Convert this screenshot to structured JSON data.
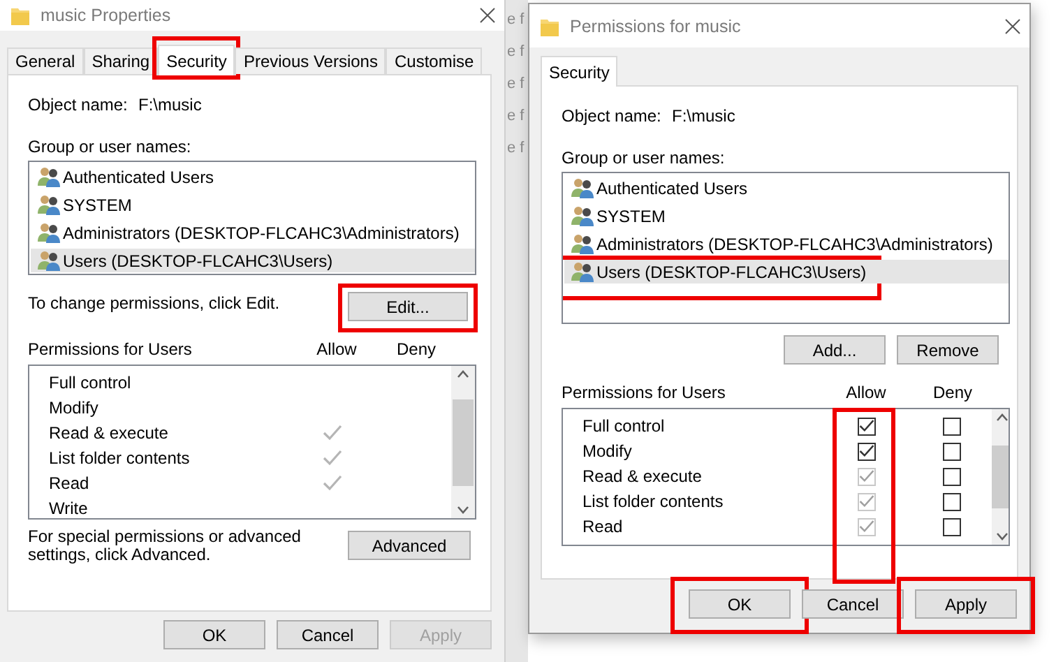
{
  "properties_window": {
    "title": "music Properties",
    "tabs": [
      {
        "label": "General",
        "selected": false,
        "highlighted": false
      },
      {
        "label": "Sharing",
        "selected": false,
        "highlighted": false
      },
      {
        "label": "Security",
        "selected": true,
        "highlighted": true
      },
      {
        "label": "Previous Versions",
        "selected": false,
        "highlighted": false
      },
      {
        "label": "Customise",
        "selected": false,
        "highlighted": false
      }
    ],
    "object_label": "Object name:",
    "object_value": "F:\\music",
    "group_label": "Group or user names:",
    "users": [
      {
        "name": "Authenticated Users",
        "selected": false,
        "highlighted": false
      },
      {
        "name": "SYSTEM",
        "selected": false,
        "highlighted": false
      },
      {
        "name": "Administrators (DESKTOP-FLCAHC3\\Administrators)",
        "selected": false,
        "highlighted": false
      },
      {
        "name": "Users (DESKTOP-FLCAHC3\\Users)",
        "selected": true,
        "highlighted": false
      }
    ],
    "edit_hint": "To change permissions, click Edit.",
    "edit_button": {
      "label": "Edit...",
      "highlighted": true
    },
    "permissions_label": "Permissions for Users",
    "allow_label": "Allow",
    "deny_label": "Deny",
    "permissions": [
      {
        "label": "Full control",
        "allow": false,
        "deny": false
      },
      {
        "label": "Modify",
        "allow": false,
        "deny": false
      },
      {
        "label": "Read & execute",
        "allow": true,
        "deny": false
      },
      {
        "label": "List folder contents",
        "allow": true,
        "deny": false
      },
      {
        "label": "Read",
        "allow": true,
        "deny": false
      },
      {
        "label": "Write",
        "allow": false,
        "deny": false
      }
    ],
    "advanced_hint": "For special permissions or advanced settings, click Advanced.",
    "advanced_button": "Advanced",
    "buttons": [
      {
        "label": "OK",
        "disabled": false,
        "highlighted": false
      },
      {
        "label": "Cancel",
        "disabled": false,
        "highlighted": false
      },
      {
        "label": "Apply",
        "disabled": true,
        "highlighted": false
      }
    ]
  },
  "background_fragments": [
    "e f",
    "e f",
    "e f",
    "e f",
    "e f"
  ],
  "permissions_window": {
    "title": "Permissions for music",
    "tabs": [
      {
        "label": "Security",
        "selected": true,
        "highlighted": false
      }
    ],
    "object_label": "Object name:",
    "object_value": "F:\\music",
    "group_label": "Group or user names:",
    "users": [
      {
        "name": "Authenticated Users",
        "selected": false,
        "highlighted": false
      },
      {
        "name": "SYSTEM",
        "selected": false,
        "highlighted": false
      },
      {
        "name": "Administrators (DESKTOP-FLCAHC3\\Administrators)",
        "selected": false,
        "highlighted": false
      },
      {
        "name": "Users (DESKTOP-FLCAHC3\\Users)",
        "selected": true,
        "highlighted": true
      }
    ],
    "add_button": "Add...",
    "remove_button": "Remove",
    "permissions_label": "Permissions for Users",
    "allow_label": "Allow",
    "deny_label": "Deny",
    "allow_highlighted": true,
    "permissions": [
      {
        "label": "Full control",
        "allow": true,
        "allow_disabled": false,
        "deny": false
      },
      {
        "label": "Modify",
        "allow": true,
        "allow_disabled": false,
        "deny": false
      },
      {
        "label": "Read & execute",
        "allow": true,
        "allow_disabled": true,
        "deny": false
      },
      {
        "label": "List folder contents",
        "allow": true,
        "allow_disabled": true,
        "deny": false
      },
      {
        "label": "Read",
        "allow": true,
        "allow_disabled": true,
        "deny": false
      }
    ],
    "buttons": [
      {
        "label": "OK",
        "disabled": false,
        "highlighted": true
      },
      {
        "label": "Cancel",
        "disabled": false,
        "highlighted": false
      },
      {
        "label": "Apply",
        "disabled": false,
        "highlighted": true
      }
    ]
  }
}
